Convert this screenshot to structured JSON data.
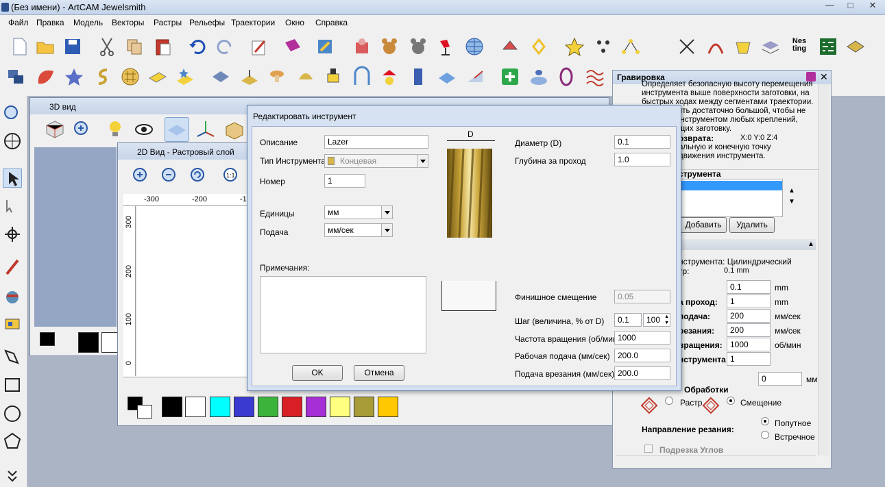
{
  "window": {
    "title": "(Без имени) - ArtCAM Jewelsmith",
    "minimize": "—",
    "maximize": "□",
    "close": "✕"
  },
  "menu": [
    "Файл",
    "Правка",
    "Модель",
    "Векторы",
    "Растры",
    "Рельефы",
    "Траектории",
    "Окно",
    "Справка"
  ],
  "toolbar": {
    "nesting_label": "Nes\nting"
  },
  "view3d": {
    "title": "3D вид"
  },
  "view2d": {
    "title": "2D Вид - Растровый слой",
    "ruler_h": [
      "-300",
      "-200",
      "-1"
    ],
    "ruler_v": [
      "300",
      "200",
      "100",
      "0"
    ]
  },
  "palette": {
    "colors": [
      "#000000",
      "#ffffff",
      "#00ffff",
      "#3a3ad0",
      "#3cb43c",
      "#d81f26",
      "#a62fd6",
      "#ffff80",
      "#a89c38",
      "#ffc800"
    ]
  },
  "dialog": {
    "title": "Редактировать инструмент",
    "desc_label": "Описание",
    "desc_value": "Lazer",
    "type_label": "Тип Инструмента",
    "type_value": "Концевая",
    "number_label": "Номер",
    "number_value": "1",
    "units_label": "Единицы",
    "units_value": "мм",
    "feed_label": "Подача",
    "feed_value": "мм/сек",
    "notes_label": "Примечания:",
    "diam_label": "Диаметр (D)",
    "diam_value": "0.1",
    "depth_label": "Глубина за проход",
    "depth_value": "1.0",
    "img_d": "D",
    "finish_label": "Финишное смещение",
    "finish_value": "0.05",
    "step_label": "Шаг (величина, % от D)",
    "step_value": "0.1",
    "step_pct": "100",
    "spindle_label": "Частота вращения (об/мин)",
    "spindle_value": "1000",
    "workfeed_label": "Рабочая подача (мм/сек)",
    "workfeed_value": "200.0",
    "plunge_label": "Подача врезания (мм/сек)",
    "plunge_value": "200.0",
    "ok": "OK",
    "cancel": "Отмена"
  },
  "panel": {
    "title": "Гравировка",
    "info1": "Определяет безопасную высоту перемещения инструмента выше поверхности заготовки, на быстрых ходах между сегментами траектории. Должна быть достаточно большой, чтобы не касаться инструментом любых креплений, фиксирующих заготовку.",
    "home_label": "озврата:",
    "home_value": "X:0 Y:0 Z:4",
    "home_desc": "альную и конечную точку движения инструмента.",
    "tools_header": "струмента",
    "add": "Добавить",
    "remove": "Удалить",
    "tooltype": "нструмента: Цилиндрический",
    "diam_short": "тр:",
    "diam_short_val": "0.1 mm",
    "f1_val": "0.1",
    "f1_unit": "mm",
    "f2_label": "а проход:",
    "f2_val": "1",
    "f2_unit": "mm",
    "f3_label": "подача:",
    "f3_val": "200",
    "f3_unit": "мм/сек",
    "f4_label": "резания:",
    "f4_val": "200",
    "f4_unit": "мм/сек",
    "f5_label": "вращения:",
    "f5_val": "1000",
    "f5_unit": "об/мин",
    "f6_label": "нструмента:",
    "f6_val": "1",
    "f7_val": "0",
    "f7_unit": "мм",
    "mode_label": "Обработки",
    "raster": "Растр",
    "offset": "Смещение",
    "dir_label": "Направление резания:",
    "climb": "Попутное",
    "conv": "Встречное",
    "corner": "Подрезка Углов"
  }
}
